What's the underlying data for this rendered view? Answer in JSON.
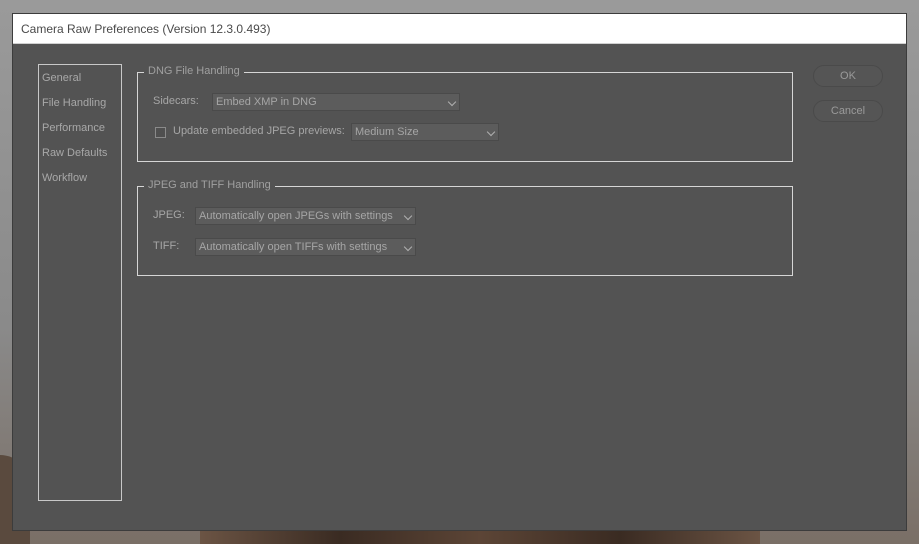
{
  "window": {
    "title": "Camera Raw Preferences  (Version 12.3.0.493)"
  },
  "sidebar": {
    "items": [
      {
        "label": "General"
      },
      {
        "label": "File Handling"
      },
      {
        "label": "Performance"
      },
      {
        "label": "Raw Defaults"
      },
      {
        "label": "Workflow"
      }
    ]
  },
  "dng": {
    "title": "DNG File Handling",
    "sidecars_label": "Sidecars:",
    "sidecars_value": "Embed XMP in DNG",
    "update_jpeg_label": "Update embedded JPEG previews:",
    "update_jpeg_checked": false,
    "preview_size_value": "Medium Size"
  },
  "jpeg_tiff": {
    "title": "JPEG and TIFF Handling",
    "jpeg_label": "JPEG:",
    "jpeg_value": "Automatically open JPEGs with settings",
    "tiff_label": "TIFF:",
    "tiff_value": "Automatically open TIFFs with settings"
  },
  "buttons": {
    "ok": "OK",
    "cancel": "Cancel"
  }
}
